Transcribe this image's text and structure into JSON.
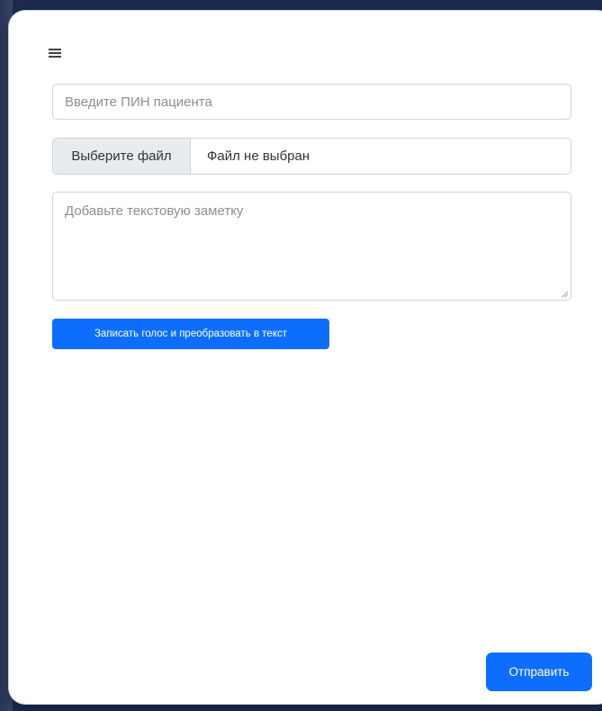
{
  "header": {
    "menu_icon": "hamburger-menu-icon"
  },
  "form": {
    "pin_placeholder": "Введите ПИН пациента",
    "pin_value": "",
    "file_button_label": "Выберите файл",
    "file_status": "Файл не выбран",
    "note_placeholder": "Добавьте текстовую заметку",
    "note_value": "",
    "voice_button_label": "Записать голос и преобразовать в текст",
    "submit_label": "Отправить"
  },
  "colors": {
    "background": "#1e2b4f",
    "card": "#ffffff",
    "primary_button": "#0d6efd",
    "file_button_bg": "#e9ecef",
    "border": "#ced4da"
  }
}
